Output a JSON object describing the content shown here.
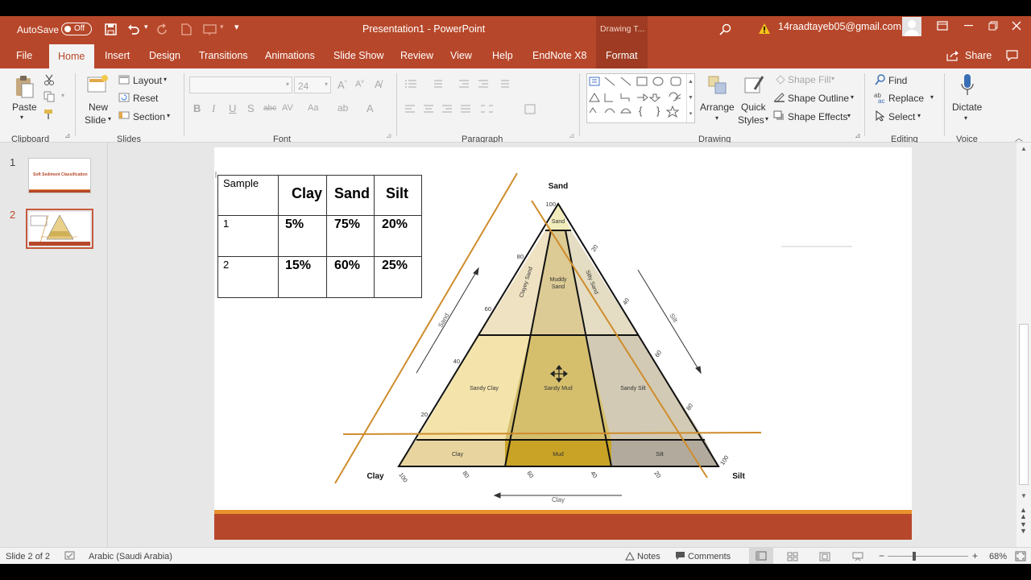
{
  "window": {
    "autosave_label": "AutoSave",
    "autosave_state": "Off",
    "title": "Presentation1  -  PowerPoint",
    "context_label": "Drawing T...",
    "account": "14raadtayeb05@gmail.com"
  },
  "tabs": [
    "File",
    "Home",
    "Insert",
    "Design",
    "Transitions",
    "Animations",
    "Slide Show",
    "Review",
    "View",
    "Help",
    "EndNote X8",
    "Format"
  ],
  "share_label": "Share",
  "ribbon": {
    "clipboard": {
      "paste": "Paste",
      "group": "Clipboard"
    },
    "slides": {
      "new_slide_1": "New",
      "new_slide_2": "Slide",
      "layout": "Layout",
      "reset": "Reset",
      "section": "Section",
      "group": "Slides"
    },
    "font": {
      "size": "24",
      "group": "Font"
    },
    "paragraph": {
      "group": "Paragraph"
    },
    "drawing": {
      "arrange": "Arrange",
      "quick_styles_1": "Quick",
      "quick_styles_2": "Styles",
      "shape_fill": "Shape Fill",
      "shape_outline": "Shape Outline",
      "shape_effects": "Shape Effects",
      "group": "Drawing"
    },
    "editing": {
      "find": "Find",
      "replace": "Replace",
      "select": "Select",
      "group": "Editing"
    },
    "voice": {
      "dictate": "Dictate",
      "group": "Voice"
    }
  },
  "thumbnails": [
    {
      "number": "1",
      "caption": "Soft Sediment Classification"
    },
    {
      "number": "2",
      "caption": ""
    }
  ],
  "table": {
    "headers": [
      "Sample",
      "Clay",
      "Sand",
      "Silt"
    ],
    "rows": [
      [
        "1",
        "5%",
        "75%",
        "20%"
      ],
      [
        "2",
        "15%",
        "60%",
        "25%"
      ]
    ]
  },
  "diagram": {
    "corner_sand": "Sand",
    "corner_clay": "Clay",
    "corner_silt": "Silt",
    "regions": {
      "sand": "Sand",
      "clayey_sand": "Clayey Sand",
      "muddy_sand_1": "Muddy",
      "muddy_sand_2": "Sand",
      "silty_sand": "Silty Sand",
      "sandy_clay": "Sandy Clay",
      "sandy_mud": "Sandy Mud",
      "sandy_silt": "Sandy Silt",
      "clay": "Clay",
      "mud": "Mud",
      "silt": "Silt"
    },
    "left_ticks": [
      "100",
      "80",
      "60",
      "40",
      "20"
    ],
    "right_ticks": [
      "20",
      "40",
      "60",
      "80",
      "100"
    ],
    "bottom_ticks": [
      "100",
      "80",
      "60",
      "40",
      "20"
    ],
    "axis_sand": "Sand",
    "axis_silt": "Silt",
    "axis_clay": "Clay",
    "colors": {
      "sand": "#f2ecbc",
      "clayey_sand": "#efe2c2",
      "muddy_sand": "#dccb95",
      "silty_sand": "#e4ddc3",
      "sandy_clay": "#f4e4ab",
      "sandy_mud": "#d5bf6d",
      "sandy_silt": "#d2cab4",
      "clay": "#e8d49f",
      "mud": "#c9a326",
      "silt": "#b2aa9c",
      "orange_line": "#cf8c2b"
    }
  },
  "status": {
    "slide": "Slide 2 of 2",
    "language": "Arabic (Saudi Arabia)",
    "notes": "Notes",
    "comments": "Comments",
    "zoom": "68%"
  }
}
